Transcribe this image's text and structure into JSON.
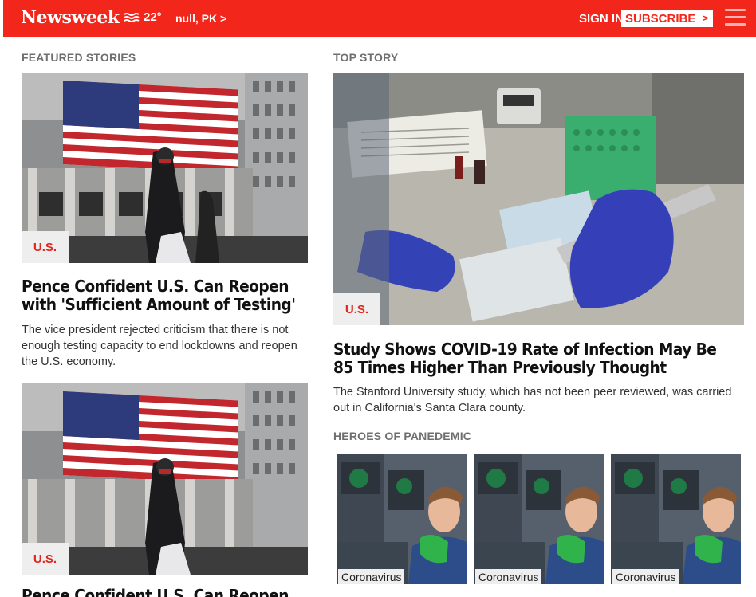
{
  "header": {
    "logo": "Newsweek",
    "temperature": "22°",
    "location": "null, PK >",
    "sign_in": "SIGN IN",
    "subscribe": "SUBSCRIBE",
    "subscribe_arrow": ">",
    "colors": {
      "brand": "#f2261b"
    }
  },
  "featured": {
    "label": "FEATURED STORIES",
    "stories": [
      {
        "tag": "U.S.",
        "headline": "Pence Confident U.S. Can Reopen with 'Sufficient Amount of Testing'",
        "summary": "The vice president rejected criticism that there is not enough testing capacity to end lockdowns and reopen the U.S. economy."
      },
      {
        "tag": "U.S.",
        "headline": "Pence Confident U.S. Can Reopen"
      }
    ]
  },
  "top_story": {
    "label": "TOP STORY",
    "tag": "U.S.",
    "headline": "Study Shows COVID-19 Rate of Infection May Be 85 Times Higher Than Previously Thought",
    "summary": "The Stanford University study, which has not been peer reviewed, was carried out in California's Santa Clara county."
  },
  "heroes": {
    "label": "HEROES OF PANEDEMIC",
    "cards": [
      {
        "tag": "Coronavirus"
      },
      {
        "tag": "Coronavirus"
      },
      {
        "tag": "Coronavirus"
      }
    ]
  }
}
